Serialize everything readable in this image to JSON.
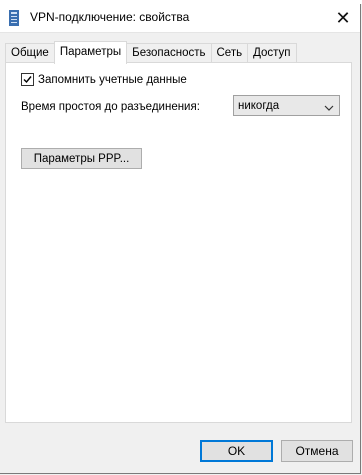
{
  "window": {
    "title": "VPN-подключение: свойства",
    "close_glyph": "✕"
  },
  "tabs": [
    {
      "label": "Общие",
      "active": false
    },
    {
      "label": "Параметры",
      "active": true
    },
    {
      "label": "Безопасность",
      "active": false
    },
    {
      "label": "Сеть",
      "active": false
    },
    {
      "label": "Доступ",
      "active": false
    }
  ],
  "options": {
    "remember_credentials_label": "Запомнить учетные данные",
    "remember_credentials_checked": true,
    "idle_time_label": "Время простоя до разъединения:",
    "idle_time_value": "никогда",
    "ppp_button_label": "Параметры PPP..."
  },
  "footer": {
    "ok_label": "OK",
    "cancel_label": "Отмена"
  },
  "icons": {
    "window_icon": "vpn-connection-icon",
    "close": "close-icon",
    "checkmark": "checkmark-icon",
    "dropdown": "chevron-down-icon"
  },
  "colors": {
    "accent": "#0078d7",
    "window_bg": "#f0f0f0",
    "panel_bg": "#ffffff"
  }
}
